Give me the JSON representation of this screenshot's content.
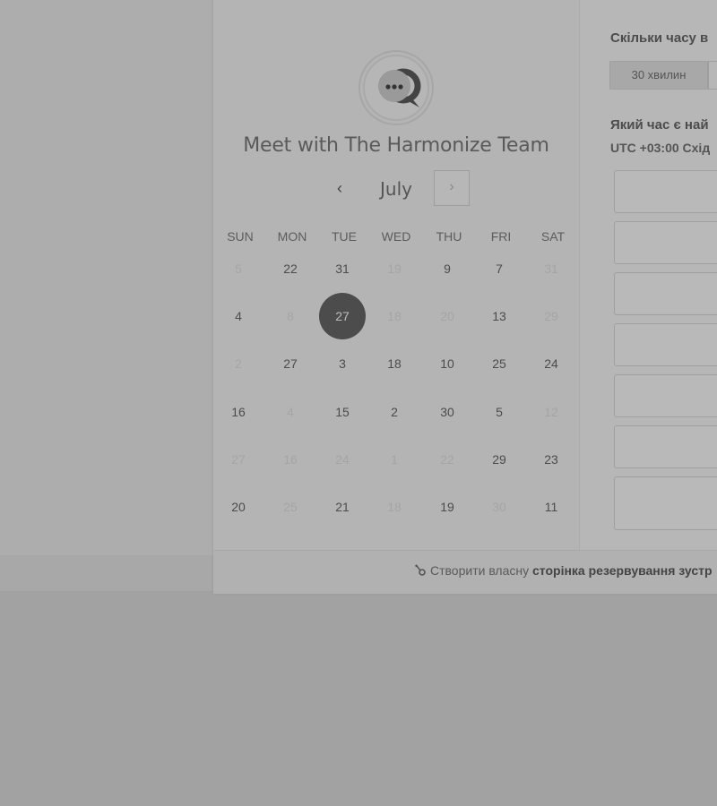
{
  "meeting": {
    "title": "Meet with The Harmonize Team"
  },
  "calendar": {
    "month": "July",
    "prev_icon": "chevron-left-icon",
    "next_icon": "chevron-right-icon",
    "weekdays": [
      "SUN",
      "MON",
      "TUE",
      "WED",
      "THU",
      "FRI",
      "SAT"
    ],
    "weeks": [
      [
        {
          "d": "5",
          "off": true
        },
        {
          "d": "22"
        },
        {
          "d": "31"
        },
        {
          "d": "19",
          "off": true
        },
        {
          "d": "9"
        },
        {
          "d": "7"
        },
        {
          "d": "31",
          "off": true
        }
      ],
      [
        {
          "d": "4"
        },
        {
          "d": "8",
          "off": true
        },
        {
          "d": "27",
          "selected": true
        },
        {
          "d": "18",
          "off": true
        },
        {
          "d": "20",
          "off": true
        },
        {
          "d": "13"
        },
        {
          "d": "29",
          "off": true
        }
      ],
      [
        {
          "d": "2",
          "off": true
        },
        {
          "d": "27"
        },
        {
          "d": "3"
        },
        {
          "d": "18"
        },
        {
          "d": "10"
        },
        {
          "d": "25"
        },
        {
          "d": "24"
        }
      ],
      [
        {
          "d": "16"
        },
        {
          "d": "4",
          "off": true
        },
        {
          "d": "15"
        },
        {
          "d": "2"
        },
        {
          "d": "30"
        },
        {
          "d": "5"
        },
        {
          "d": "12",
          "off": true
        }
      ],
      [
        {
          "d": "27",
          "off": true
        },
        {
          "d": "16",
          "off": true
        },
        {
          "d": "24",
          "off": true
        },
        {
          "d": "1",
          "off": true
        },
        {
          "d": "22",
          "off": true
        },
        {
          "d": "29"
        },
        {
          "d": "23"
        }
      ],
      [
        {
          "d": "20"
        },
        {
          "d": "25",
          "off": true
        },
        {
          "d": "21"
        },
        {
          "d": "18",
          "off": true
        },
        {
          "d": "19"
        },
        {
          "d": "30",
          "off": true
        },
        {
          "d": "11"
        }
      ]
    ]
  },
  "scheduler": {
    "duration_question": "Скільки часу в",
    "duration_option": "30 хвилин",
    "time_question": "Який час є най",
    "timezone": "UTC +03:00 Схід"
  },
  "footer": {
    "text_plain": "Створити власну",
    "text_bold": "сторінка резервування зустр",
    "icon": "hubspot-sprocket-icon"
  },
  "colors": {
    "selected_day": "#4c4c4c",
    "overlay_background": "#a2a2a2"
  }
}
